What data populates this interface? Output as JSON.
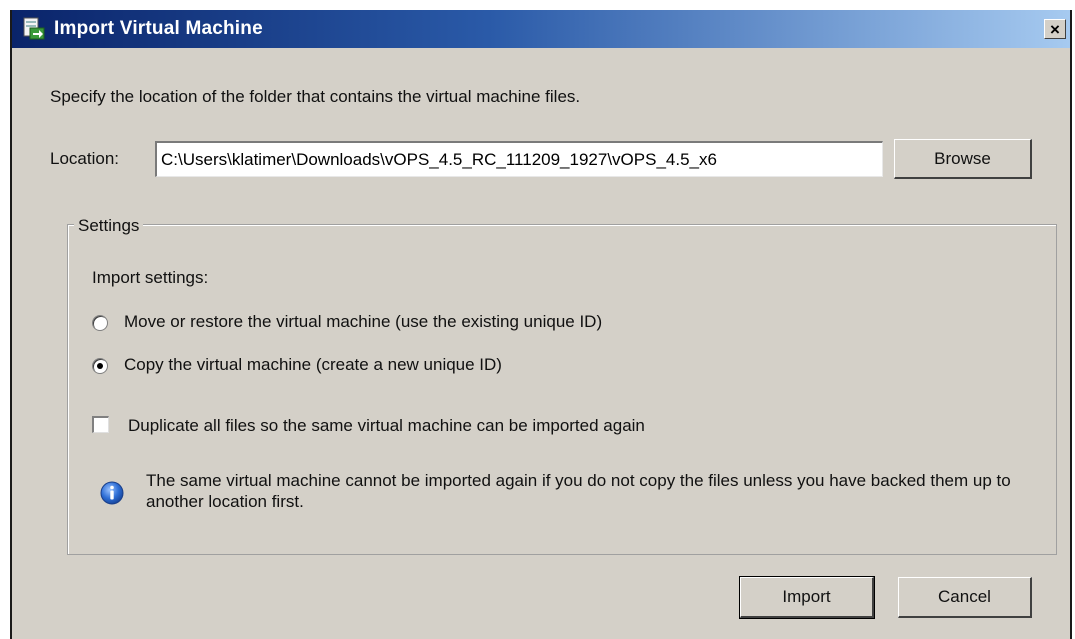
{
  "window": {
    "title": "Import Virtual Machine",
    "close_glyph": "×"
  },
  "intro_text": "Specify the location of the folder that contains the virtual machine files.",
  "location": {
    "label": "Location:",
    "value": "C:\\Users\\klatimer\\Downloads\\vOPS_4.5_RC_111209_1927\\vOPS_4.5_x6",
    "browse_label": "Browse"
  },
  "settings": {
    "group_label": "Settings",
    "import_settings_label": "Import settings:",
    "options": [
      {
        "label": "Move or restore the virtual machine (use the existing unique ID)",
        "selected": false
      },
      {
        "label": "Copy the virtual machine (create a new unique ID)",
        "selected": true
      }
    ],
    "duplicate_checkbox": {
      "label": "Duplicate all files so the same virtual machine can be imported again",
      "checked": false
    },
    "info_text": "The same virtual machine cannot be imported again if you do not copy the files unless you have backed them up to another location first."
  },
  "footer": {
    "import_label": "Import",
    "cancel_label": "Cancel"
  },
  "colors": {
    "title_gradient_start": "#0a246a",
    "title_gradient_end": "#a6caf0",
    "dialog_background": "#d4d0c8"
  },
  "icons": {
    "title": "import-vm-icon",
    "info": "info-icon"
  }
}
